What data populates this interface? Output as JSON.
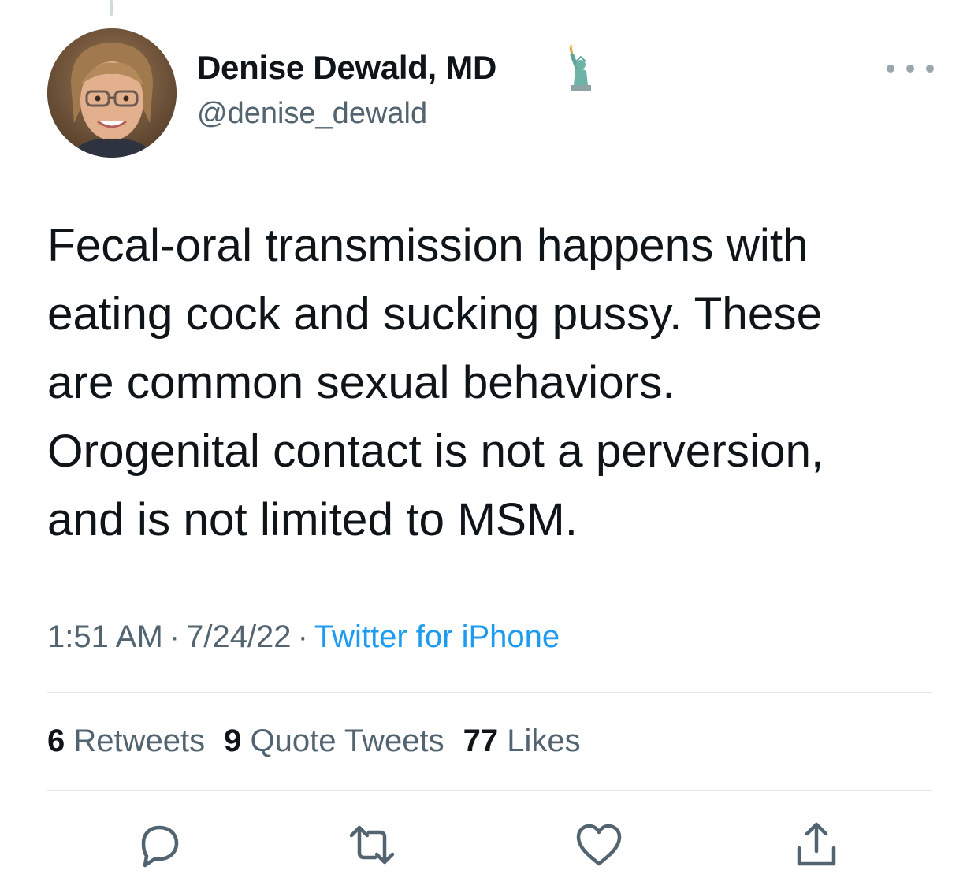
{
  "author": {
    "display_name": "Denise Dewald, MD",
    "handle": "@denise_dewald",
    "name_emoji": "statue-of-liberty-emoji"
  },
  "tweet": {
    "text_lines": [
      "Fecal-oral transmission happens with",
      "eating cock and sucking pussy. These",
      "are common sexual behaviors.",
      "Orogenital contact is not a perversion,",
      "and is not limited to MSM."
    ],
    "time": "1:51 AM",
    "date": "7/24/22",
    "separator": "·",
    "source": "Twitter for iPhone"
  },
  "stats": {
    "retweets_count": "6",
    "retweets_label": "Retweets",
    "quotes_count": "9",
    "quotes_label": "Quote Tweets",
    "likes_count": "77",
    "likes_label": "Likes"
  },
  "actions": [
    "reply-icon",
    "retweet-icon",
    "like-icon",
    "share-icon"
  ],
  "colors": {
    "text": "#0f1419",
    "secondary": "#536471",
    "link": "#1d9bf0",
    "divider": "#dfe5e9",
    "icon": "#536471"
  }
}
